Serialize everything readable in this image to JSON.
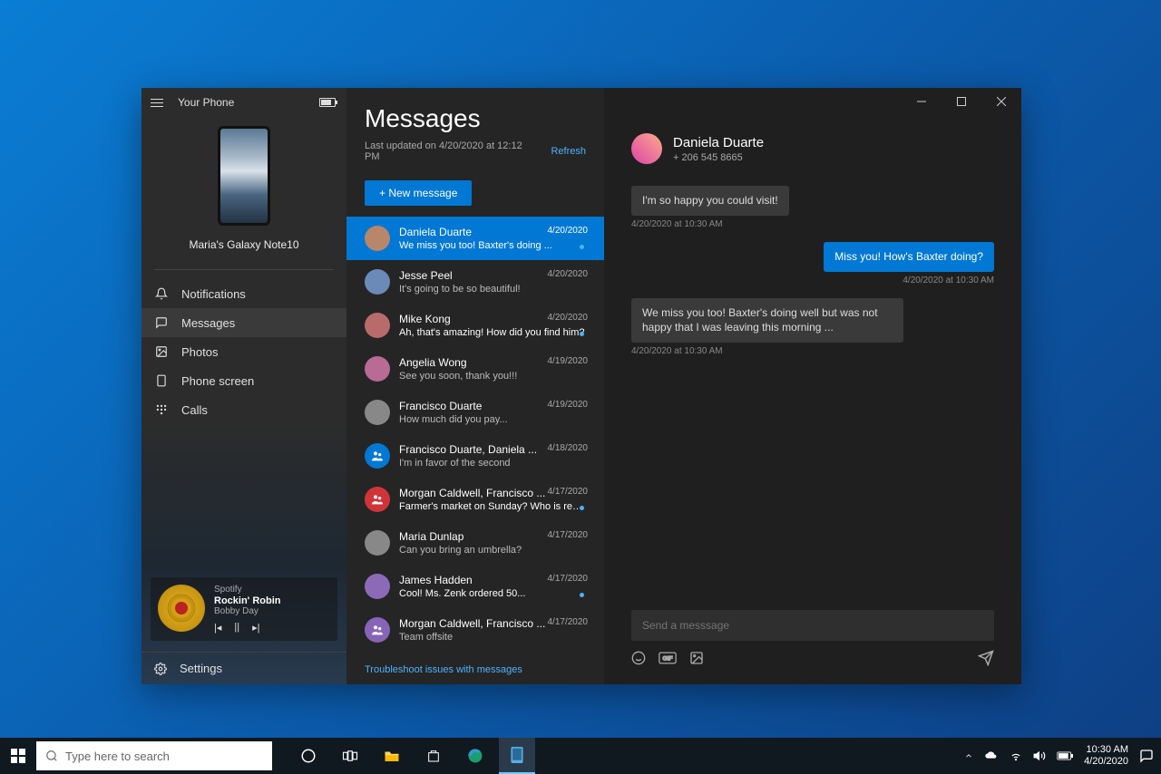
{
  "app": {
    "title": "Your Phone",
    "device_name": "Maria's Galaxy Note10"
  },
  "nav": {
    "items": [
      {
        "label": "Notifications"
      },
      {
        "label": "Messages"
      },
      {
        "label": "Photos"
      },
      {
        "label": "Phone screen"
      },
      {
        "label": "Calls"
      }
    ],
    "settings": "Settings"
  },
  "media": {
    "service": "Spotify",
    "track": "Rockin' Robin",
    "artist": "Bobby Day"
  },
  "messages": {
    "heading": "Messages",
    "last_updated": "Last updated on 4/20/2020 at 12:12 PM",
    "refresh": "Refresh",
    "new_message": "+ New message",
    "troubleshoot": "Troubleshoot issues with messages"
  },
  "threads": [
    {
      "name": "Daniela Duarte",
      "preview": "We miss you too! Baxter's doing ...",
      "date": "4/20/2020",
      "unread": true,
      "avatar_bg": "#b8866b"
    },
    {
      "name": "Jesse Peel",
      "preview": "It's going to be so beautiful!",
      "date": "4/20/2020",
      "unread": false,
      "avatar_bg": "#6b8ab8"
    },
    {
      "name": "Mike Kong",
      "preview": "Ah, that's amazing! How did you find him?",
      "date": "4/20/2020",
      "unread": true,
      "avatar_bg": "#b86b6b"
    },
    {
      "name": "Angelia Wong",
      "preview": "See you soon, thank you!!!",
      "date": "4/19/2020",
      "unread": false,
      "avatar_bg": "#b86b94"
    },
    {
      "name": "Francisco Duarte",
      "preview": "How much did you pay...",
      "date": "4/19/2020",
      "unread": false,
      "avatar_bg": "#888"
    },
    {
      "name": "Francisco Duarte, Daniela ...",
      "preview": "I'm in favor of the second",
      "date": "4/18/2020",
      "unread": false,
      "avatar_bg": "#0078d4",
      "group": true
    },
    {
      "name": "Morgan Caldwell, Francisco ...",
      "preview": "Farmer's market on Sunday? Who is ready for it?",
      "date": "4/17/2020",
      "unread": true,
      "avatar_bg": "#d13438",
      "group": true
    },
    {
      "name": "Maria Dunlap",
      "preview": "Can you bring an umbrella?",
      "date": "4/17/2020",
      "unread": false,
      "avatar_bg": "#888"
    },
    {
      "name": "James Hadden",
      "preview": "Cool! Ms. Zenk ordered 50...",
      "date": "4/17/2020",
      "unread": true,
      "avatar_bg": "#8b6bb8"
    },
    {
      "name": "Morgan Caldwell, Francisco ...",
      "preview": "Team offsite",
      "date": "4/17/2020",
      "unread": false,
      "avatar_bg": "#8764b8",
      "group": true
    }
  ],
  "chat": {
    "contact_name": "Daniela Duarte",
    "contact_phone": "+ 206 545 8665",
    "messages": [
      {
        "side": "left",
        "text": "I'm so happy you could visit!",
        "ts": "4/20/2020 at 10:30 AM"
      },
      {
        "side": "right",
        "text": "Miss you! How's Baxter doing?",
        "ts": "4/20/2020 at 10:30 AM"
      },
      {
        "side": "left",
        "text": "We miss you too! Baxter's doing well but was not happy that I was leaving this morning ...",
        "ts": "4/20/2020 at 10:30 AM"
      }
    ],
    "compose_placeholder": "Send a messsage"
  },
  "taskbar": {
    "search_placeholder": "Type here to search",
    "time": "10:30 AM",
    "date": "4/20/2020"
  }
}
